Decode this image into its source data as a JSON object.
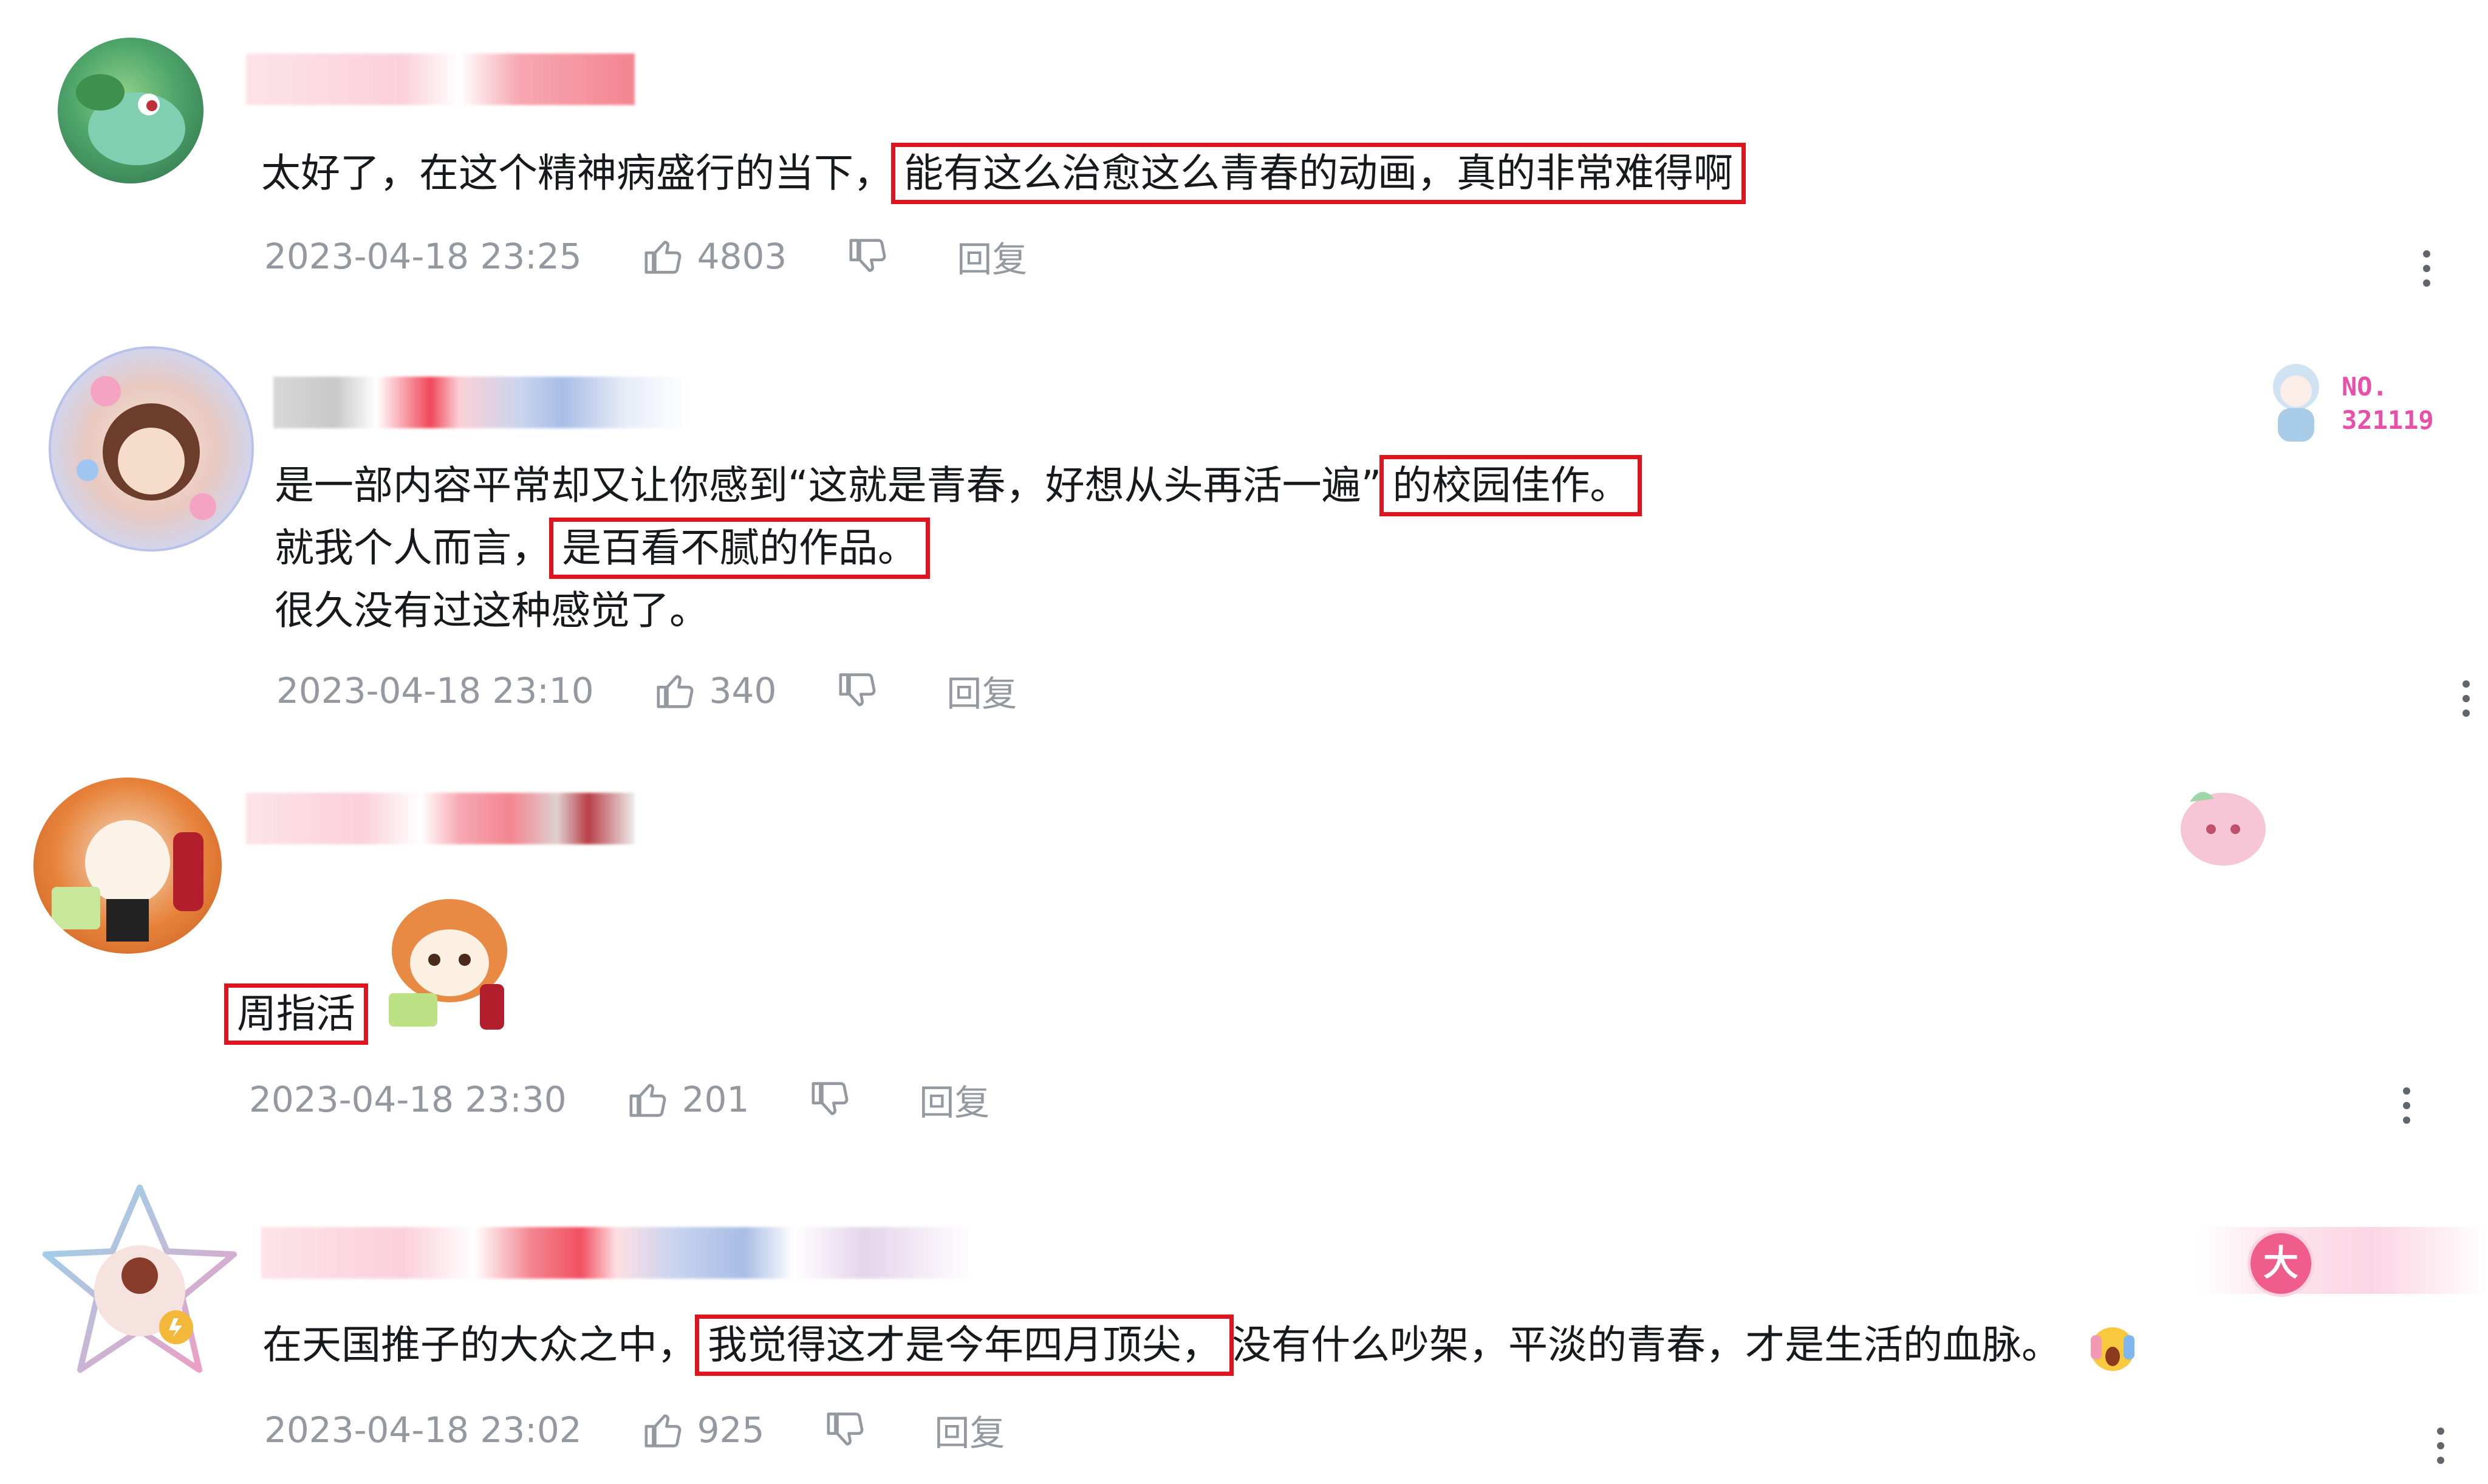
{
  "comments": [
    {
      "text": [
        "太好了，在这个精神病盛行的当下，",
        "能有这么治愈这么青春的动画，真的非常难得啊"
      ],
      "time": "2023-04-18 23:25",
      "likes": "4803",
      "reply": "回复"
    },
    {
      "line1": [
        "是一部内容平常却又让你感到“这就是青春，好想从头再活一遍”",
        "的校园佳作。"
      ],
      "line2": [
        "就我个人而言，",
        "是百看不腻的作品。"
      ],
      "line3": "很久没有过这种感觉了。",
      "time": "2023-04-18 23:10",
      "likes": "340",
      "reply": "回复",
      "fan_badge": {
        "prefix": "NO.",
        "number": "321119"
      }
    },
    {
      "text": "周指活",
      "time": "2023-04-18 23:30",
      "likes": "201",
      "reply": "回复"
    },
    {
      "text": [
        "在天国推子的大众之中，",
        "我觉得这才是今年四月顶尖，",
        "没有什么吵架，平淡的青春，才是生活的血脉。"
      ],
      "time": "2023-04-18 23:02",
      "likes": "925",
      "reply": "回复",
      "level_badge": "大"
    }
  ],
  "colors": {
    "highlight": "#e0141e",
    "meta": "#9499a0",
    "text": "#18191c",
    "badge_pink": "#e84fa8"
  }
}
